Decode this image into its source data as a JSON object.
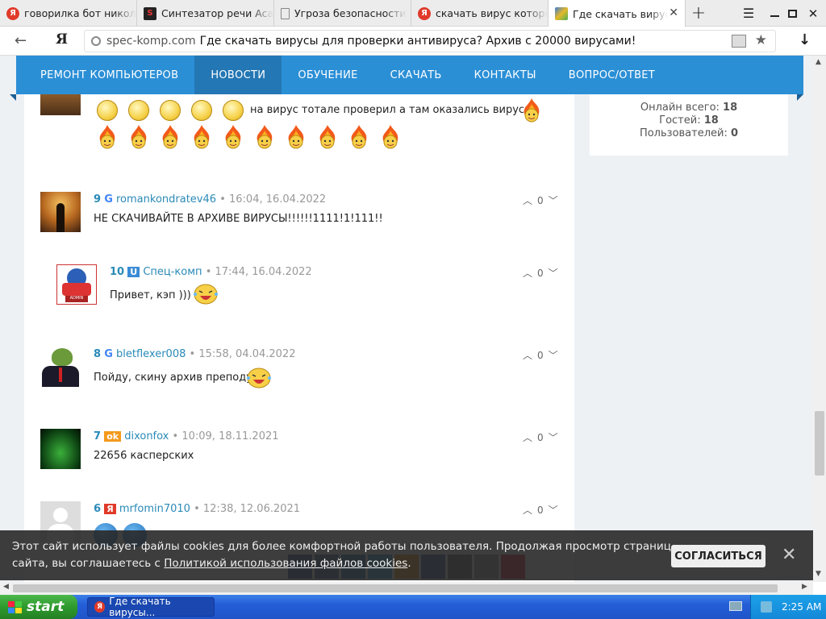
{
  "tabs": [
    {
      "title": "говорилка бот никола",
      "icon": "yandex-icon",
      "color": "#e03a2a",
      "active": false
    },
    {
      "title": "Синтезатор речи Acap",
      "icon": "acapela-icon",
      "color": "#222",
      "active": false
    },
    {
      "title": "Угроза безопасности",
      "icon": "page-icon",
      "color": "#888",
      "active": false
    },
    {
      "title": "скачать вирус который",
      "icon": "yandex-icon",
      "color": "#e03a2a",
      "active": false
    },
    {
      "title": "Где скачать вирусы",
      "icon": "site-icon",
      "color": "#3a7bd5",
      "active": true
    }
  ],
  "address": {
    "domain": "spec-komp.com",
    "title": "Где скачать вирусы для проверки антивируса? Архив с 20000 вирусами!"
  },
  "nav": [
    "РЕМОНТ КОМПЬЮТЕРОВ",
    "НОВОСТИ",
    "ОБУЧЕНИЕ",
    "СКАЧАТЬ",
    "КОНТАКТЫ",
    "ВОПРОС/ОТВЕТ"
  ],
  "stats": {
    "online_label": "Онлайн всего:",
    "online": "18",
    "guests_label": "Гостей:",
    "guests": "18",
    "users_label": "Пользователей:",
    "users": "0"
  },
  "top_comment_text": "на вирус тотале проверил а там оказались вирусы",
  "comments": [
    {
      "num": "9",
      "source": "google",
      "user": "romankondratev46",
      "date": "16:04, 16.04.2022",
      "text": "НЕ СКАЧИВАЙТЕ В АРХИВЕ ВИРУСЫ!!!!!!1111!1!111!!",
      "votes": "0"
    },
    {
      "num": "10",
      "source": "ucoz",
      "user": "Спец-комп",
      "date": "17:44, 16.04.2022",
      "text": "Привет, кэп )))",
      "votes": "0",
      "reply": true
    },
    {
      "num": "8",
      "source": "google",
      "user": "bletflexer008",
      "date": "15:58, 04.04.2022",
      "text": "Пойду, скину архив преподу",
      "votes": "0"
    },
    {
      "num": "7",
      "source": "ok",
      "user": "dixonfox",
      "date": "10:09, 18.11.2021",
      "text": "22656 касперских",
      "votes": "0"
    },
    {
      "num": "6",
      "source": "yandex",
      "user": "mrfomin7010",
      "date": "12:38, 12.06.2021",
      "text": "",
      "votes": "0"
    }
  ],
  "cookie": {
    "text1": "Этот сайт использует файлы cookies для более комфортной работы пользователя. Продолжая просмотр страниц",
    "text2": "сайта, вы соглашаетесь с ",
    "link": "Политикой использования файлов cookies",
    "text3": ".",
    "button": "СОГЛАСИТЬСЯ"
  },
  "taskbar": {
    "start": "start",
    "task": "Где скачать вирусы...",
    "time": "2:25 AM"
  }
}
